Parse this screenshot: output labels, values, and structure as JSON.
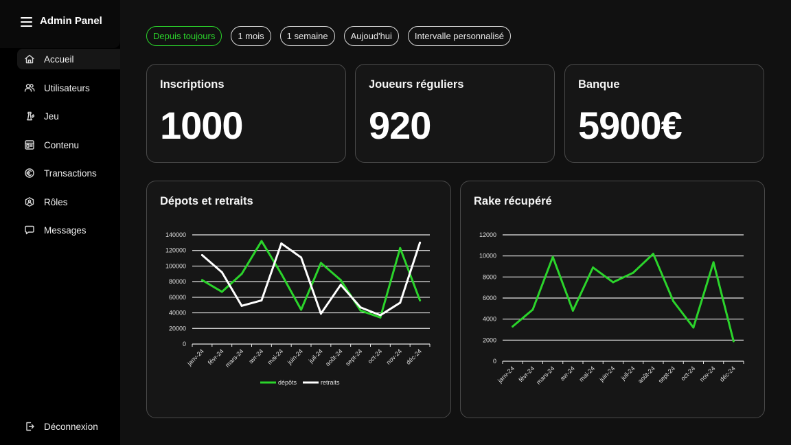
{
  "sidebar": {
    "title": "Admin Panel",
    "items": [
      {
        "label": "Accueil",
        "icon": "home-icon"
      },
      {
        "label": "Utilisateurs",
        "icon": "users-icon"
      },
      {
        "label": "Jeu",
        "icon": "game-icon"
      },
      {
        "label": "Contenu",
        "icon": "content-icon"
      },
      {
        "label": "Transactions",
        "icon": "euro-icon"
      },
      {
        "label": "Rôles",
        "icon": "roles-icon"
      },
      {
        "label": "Messages",
        "icon": "message-icon"
      }
    ],
    "logout": "Déconnexion",
    "active_item": "Accueil"
  },
  "filters": {
    "options": [
      "Depuis toujours",
      "1 mois",
      "1 semaine",
      "Aujoud'hui",
      "Intervalle personnalisé"
    ],
    "selected": "Depuis toujours"
  },
  "stats": [
    {
      "title": "Inscriptions",
      "value": "1000"
    },
    {
      "title": "Joueurs réguliers",
      "value": "920"
    },
    {
      "title": "Banque",
      "value": "5900€"
    }
  ],
  "colors": {
    "accent": "#2bd42b",
    "background": "#111111",
    "sidebar": "#000000",
    "card": "#161616",
    "secondary_line": "#ffffff"
  },
  "chart_data": [
    {
      "type": "line",
      "title": "Dépots et retraits",
      "categories": [
        "janv-24",
        "févr-24",
        "mars-24",
        "avr-24",
        "mai-24",
        "juin-24",
        "juil-24",
        "août-24",
        "sept-24",
        "oct-24",
        "nov-24",
        "déc-24"
      ],
      "series": [
        {
          "name": "dépôts",
          "color": "#2bd42b",
          "values": [
            82000,
            67000,
            90000,
            132000,
            90000,
            44000,
            104000,
            82000,
            43000,
            34000,
            123000,
            56000
          ]
        },
        {
          "name": "retraits",
          "color": "#ffffff",
          "values": [
            114000,
            92000,
            49000,
            56000,
            129000,
            111000,
            39000,
            76000,
            47000,
            37000,
            53000,
            130000
          ]
        }
      ],
      "ylim": [
        0,
        140000
      ],
      "yticks": [
        0,
        20000,
        40000,
        60000,
        80000,
        100000,
        120000,
        140000
      ],
      "grid": true,
      "legend": "bottom"
    },
    {
      "type": "line",
      "title": "Rake récupéré",
      "categories": [
        "janv-24",
        "févr-24",
        "mars-24",
        "avr-24",
        "mai-24",
        "juin-24",
        "juil-24",
        "août-24",
        "sept-24",
        "oct-24",
        "nov-24",
        "déc-24"
      ],
      "series": [
        {
          "color": "#2bd42b",
          "values": [
            3300,
            4900,
            9900,
            4800,
            8900,
            7500,
            8400,
            10200,
            5700,
            3200,
            9400,
            1900
          ]
        }
      ],
      "ylim": [
        0,
        12000
      ],
      "yticks": [
        0,
        2000,
        4000,
        6000,
        8000,
        10000,
        12000
      ],
      "grid": true,
      "legend": "none"
    }
  ]
}
